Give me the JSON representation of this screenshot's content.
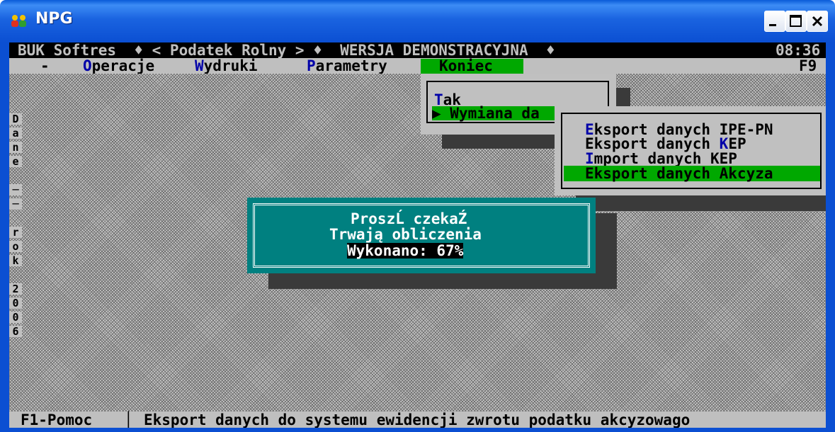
{
  "window": {
    "title": "NPG",
    "buttons": {
      "minimize": "_",
      "maximize": "□",
      "close": "×"
    }
  },
  "console": {
    "topbar": {
      "left": "BUK Softres  ♦ < Podatek Rolny > ♦  WERSJA DEMONSTRACYJNA  ♦",
      "time": "08:36"
    },
    "menu": {
      "dash": "-",
      "items": [
        {
          "hotkey": "O",
          "rest": "peracje"
        },
        {
          "hotkey": "W",
          "rest": "ydruki"
        },
        {
          "hotkey": "P",
          "rest": "arametry"
        },
        {
          "hotkey": "",
          "rest": "Koniec"
        }
      ],
      "fkey": "F9"
    },
    "koniec_menu": {
      "tak": {
        "hotkey": "T",
        "rest": "ak"
      },
      "wymiana": "▶ Wymiana da"
    },
    "submenu": [
      {
        "hotkey": "E",
        "rest": "ksport danych IPE-PN",
        "before": ""
      },
      {
        "before": "Eksport danych ",
        "hotkey": "K",
        "rest": "EP"
      },
      {
        "hotkey": "I",
        "rest": "mport danych KEP",
        "before": ""
      },
      {
        "before": "",
        "hotkey": "",
        "rest": "Eksport danych Akcyza"
      }
    ],
    "dialog": {
      "line1": "ProszĹ czekaŹ",
      "line2": "Trwają obliczenia",
      "line3": "Wykonano: 67%",
      "progress_percent": 67
    },
    "sidebar_chars": [
      "D",
      "a",
      "n",
      "e",
      " ",
      "─",
      "─",
      " ",
      "r",
      "o",
      "k",
      " ",
      "2",
      "0",
      "0",
      "6"
    ],
    "status": {
      "help": "F1-Pomoc",
      "sep": "│",
      "message": "Eksport danych do systemu ewidencji zwrotu podatku akcyzowago"
    }
  }
}
